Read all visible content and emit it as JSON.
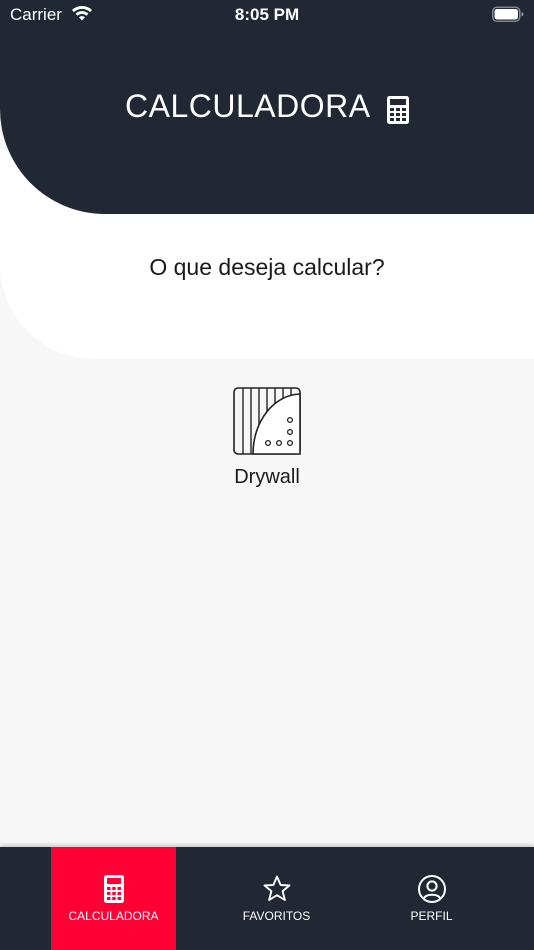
{
  "status_bar": {
    "carrier": "Carrier",
    "time": "8:05 PM"
  },
  "header": {
    "title": "CALCULADORA",
    "icon": "calculator-icon",
    "background": "#212834"
  },
  "prompt": "O que deseja calcular?",
  "options": [
    {
      "label": "Drywall",
      "icon": "drywall-icon"
    }
  ],
  "tab_bar": {
    "active_color": "#ff0035",
    "tabs": [
      {
        "label": "CALCULADORA",
        "icon": "calculator-icon",
        "active": true
      },
      {
        "label": "FAVORITOS",
        "icon": "star-icon",
        "active": false
      },
      {
        "label": "PERFIL",
        "icon": "profile-icon",
        "active": false
      }
    ]
  }
}
